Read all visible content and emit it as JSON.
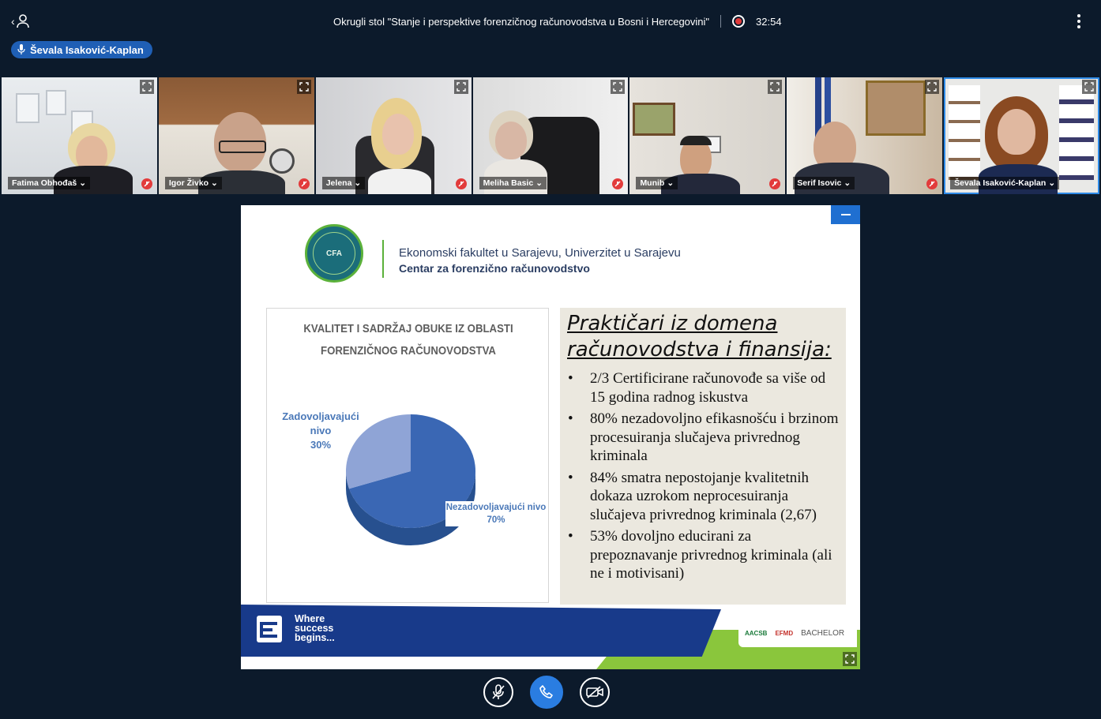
{
  "header": {
    "meeting_title": "Okrugli stol \"Stanje i perspektive forenzičnog računovodstva u Bosni i Hercegovini\"",
    "timer": "32:54",
    "active_speaker": "Ševala Isaković-Kaplan"
  },
  "participants": [
    {
      "name": "Fatima Obhođaš",
      "muted": true
    },
    {
      "name": "Igor Živko",
      "muted": true
    },
    {
      "name": "Jelena",
      "muted": true
    },
    {
      "name": "Meliha Basic",
      "muted": true
    },
    {
      "name": "Munib",
      "muted": true
    },
    {
      "name": "Serif Isovic",
      "muted": true
    },
    {
      "name": "Ševala Isaković-Kaplan",
      "muted": false
    }
  ],
  "slide": {
    "institution_line1": "Ekonomski fakultet u Sarajevu, Univerzitet u Sarajevu",
    "institution_line2": "Centar za forenzično računovodstvo",
    "logo_text": "CFA",
    "chart_heading": "KVALITET I SADRŽAJ OBUKE IZ OBLASTI FORENZIČNOG RAČUNOVODSTVA",
    "text_heading": "Praktičari iz domena računovodstva i finansija:",
    "bullets": [
      "2/3 Certificirane računovođe sa više od 15 godina radnog iskustva",
      "80% nezadovoljno efikasnošću i brzinom procesuiranja slučajeva privrednog kriminala",
      "84% smatra nepostojanje kvalitetnih dokaza uzrokom neprocesuiranja slučajeva privrednog kriminala (2,67)",
      "53% dovoljno educirani za prepoznavanje privrednog kriminala (ali ne i motivisani)"
    ],
    "slogan": [
      "Where",
      "success",
      "begins..."
    ],
    "accreditation": [
      "AACSB",
      "EFMD",
      "BACHELOR"
    ]
  },
  "chart_data": {
    "type": "pie",
    "title": "KVALITET I SADRŽAJ OBUKE IZ OBLASTI FORENZIČNOG RAČUNOVODSTVA",
    "categories": [
      "Zadovoljavajući nivo",
      "Nezadovoljavajući nivo"
    ],
    "values": [
      30,
      70
    ],
    "labels": [
      "30%",
      "70%"
    ],
    "colors": [
      "#8fa4d6",
      "#3a67b4"
    ]
  },
  "colors": {
    "background": "#0c1a2b",
    "accent": "#1f6fd1",
    "mute": "#e23b3b"
  },
  "icons": {
    "back": "back-person-icon",
    "record": "record-icon",
    "more": "more-vertical-icon",
    "mic": "microphone-icon",
    "expand": "expand-icon",
    "mute": "muted-mic-icon",
    "call": "phone-icon",
    "video": "video-off-icon"
  }
}
